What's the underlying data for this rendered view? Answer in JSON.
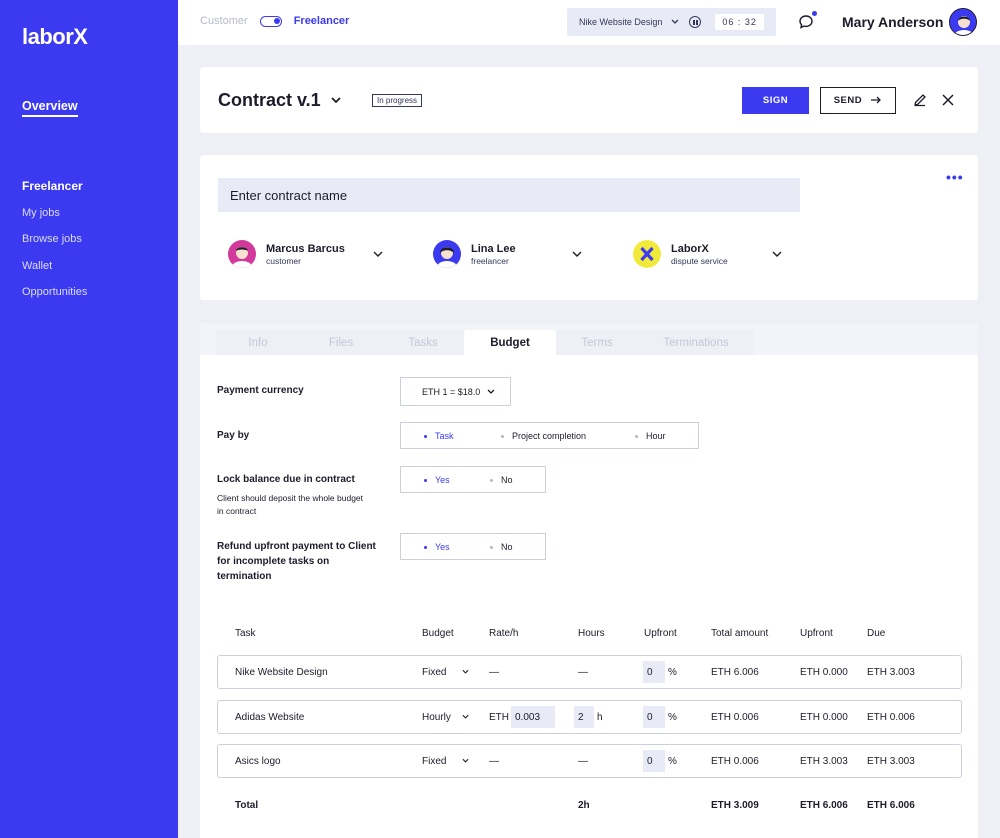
{
  "sidebar": {
    "logo": "laborX",
    "overview": "Overview",
    "section": "Freelancer",
    "items": [
      "My jobs",
      "Browse jobs",
      "Wallet",
      "Opportunities"
    ]
  },
  "topbar": {
    "toggle_left": "Customer",
    "toggle_right": "Freelancer",
    "timer_project": "Nike Website Design",
    "timer_time": "06 : 32",
    "user_name": "Mary Anderson"
  },
  "contract": {
    "title": "Contract v.1",
    "status": "In progress",
    "sign_label": "SIGN",
    "send_label": "SEND"
  },
  "parties_card": {
    "name_placeholder": "Enter contract name",
    "parties": [
      {
        "name": "Marcus Barcus",
        "role": "customer"
      },
      {
        "name": "Lina Lee",
        "role": "freelancer"
      },
      {
        "name": "LaborX",
        "role": "dispute service"
      }
    ]
  },
  "tabs": [
    "Info",
    "Files",
    "Tasks",
    "Budget",
    "Terms",
    "Terminations"
  ],
  "active_tab": "Budget",
  "budget": {
    "payment_currency_label": "Payment currency",
    "currency_value": "ETH 1 = $18.0",
    "pay_by_label": "Pay by",
    "pay_by_options": [
      "Task",
      "Project completion",
      "Hour"
    ],
    "lock_label": "Lock balance due in contract",
    "lock_sub": "Client should deposit the whole budget in contract",
    "yes": "Yes",
    "no": "No",
    "refund_label": "Refund upfront payment to Client for incomplete tasks on termination"
  },
  "table": {
    "headers": [
      "Task",
      "Budget",
      "Rate/h",
      "Hours",
      "Upfront",
      "Total amount",
      "Upfront",
      "Due"
    ],
    "rows": [
      {
        "task": "Nike Website Design",
        "budget": "Fixed",
        "rate": "—",
        "hours": "—",
        "upfront": "0",
        "total": "ETH 6.006",
        "upfront_amt": "ETH 0.000",
        "due": "ETH 3.003"
      },
      {
        "task": "Adidas Website",
        "budget": "Hourly",
        "rate_prefix": "ETH",
        "rate": "0.003",
        "hours": "2",
        "hours_unit": "h",
        "upfront": "0",
        "total": "ETH 0.006",
        "upfront_amt": "ETH 0.000",
        "due": "ETH 0.006"
      },
      {
        "task": "Asics logo",
        "budget": "Fixed",
        "rate": "—",
        "hours": "—",
        "upfront": "0",
        "total": "ETH 0.006",
        "upfront_amt": "ETH 3.003",
        "due": "ETH 3.003"
      }
    ],
    "percent": "%",
    "total": {
      "label": "Total",
      "hours": "2h",
      "total": "ETH 3.009",
      "upfront_amt": "ETH 6.006",
      "due": "ETH 6.006"
    }
  },
  "colors": {
    "brand": "#3b3af0",
    "dark": "#1c1c2b",
    "muted": "#b6b9c8"
  }
}
